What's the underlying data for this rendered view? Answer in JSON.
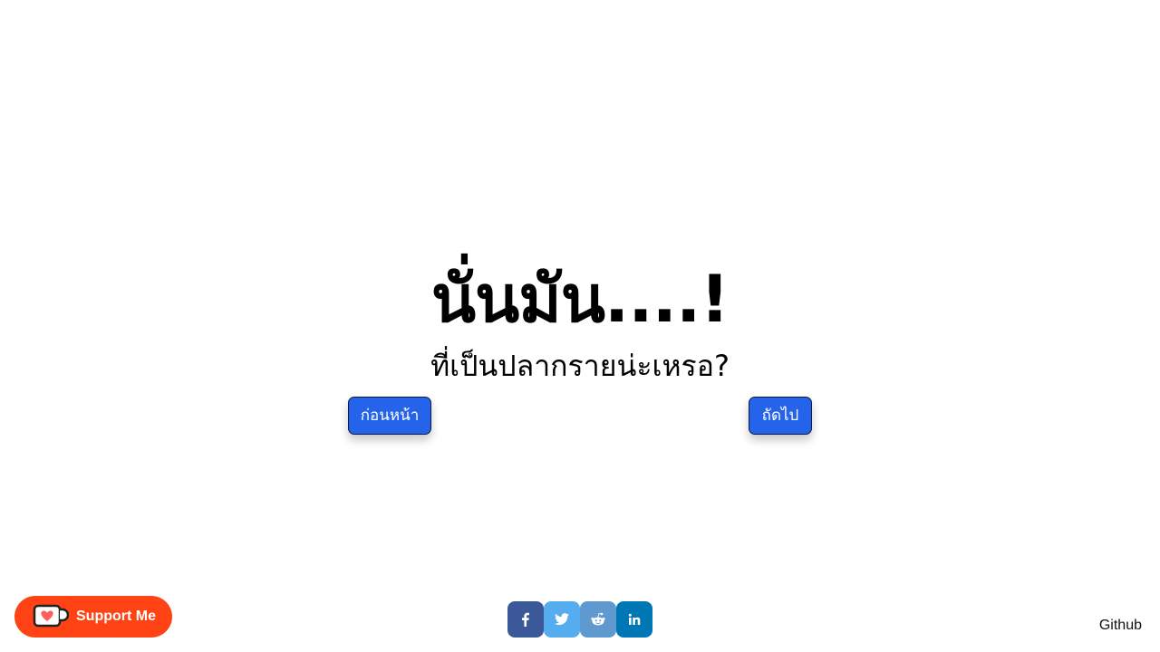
{
  "main": {
    "headline": "นั่นมัน....!",
    "subline": "ที่เป็นปลากรายน่ะเหรอ?",
    "prev_label": "ก่อนหน้า",
    "next_label": "ถัดไป"
  },
  "support": {
    "label": "Support Me",
    "icon": "ko-fi-cup-icon",
    "color": "#ff4314"
  },
  "share": {
    "buttons": [
      {
        "name": "facebook",
        "icon": "facebook-icon",
        "color": "#3b5998"
      },
      {
        "name": "twitter",
        "icon": "twitter-icon",
        "color": "#55acee"
      },
      {
        "name": "reddit",
        "icon": "reddit-icon",
        "color": "#5f99cf"
      },
      {
        "name": "linkedin",
        "icon": "linkedin-icon",
        "color": "#0077b5"
      }
    ]
  },
  "footer": {
    "github_label": "Github"
  },
  "colors": {
    "button_bg": "#2563eb",
    "button_border": "#0b1a44"
  }
}
